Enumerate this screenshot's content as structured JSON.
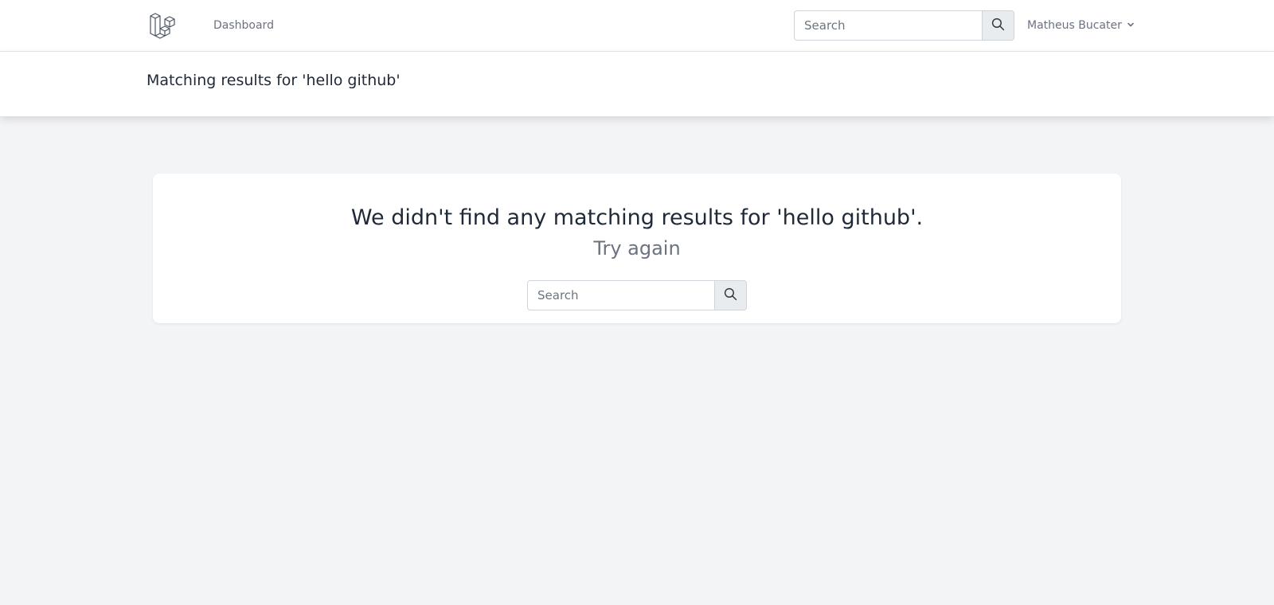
{
  "nav": {
    "dashboard_label": "Dashboard",
    "search_placeholder": "Search",
    "user_name": "Matheus Bucater"
  },
  "header": {
    "title": "Matching results for 'hello github'"
  },
  "results": {
    "message": "We didn't find any matching results for 'hello github'.",
    "try_again": "Try again",
    "search_placeholder": "Search"
  },
  "colors": {
    "page_bg": "#f3f4f6",
    "card_bg": "#ffffff",
    "muted_text": "#6b7280",
    "button_bg": "#e9ecef"
  },
  "icons": {
    "logo": "laravel-logo-icon",
    "search": "search-icon",
    "dropdown": "chevron-down-icon"
  }
}
